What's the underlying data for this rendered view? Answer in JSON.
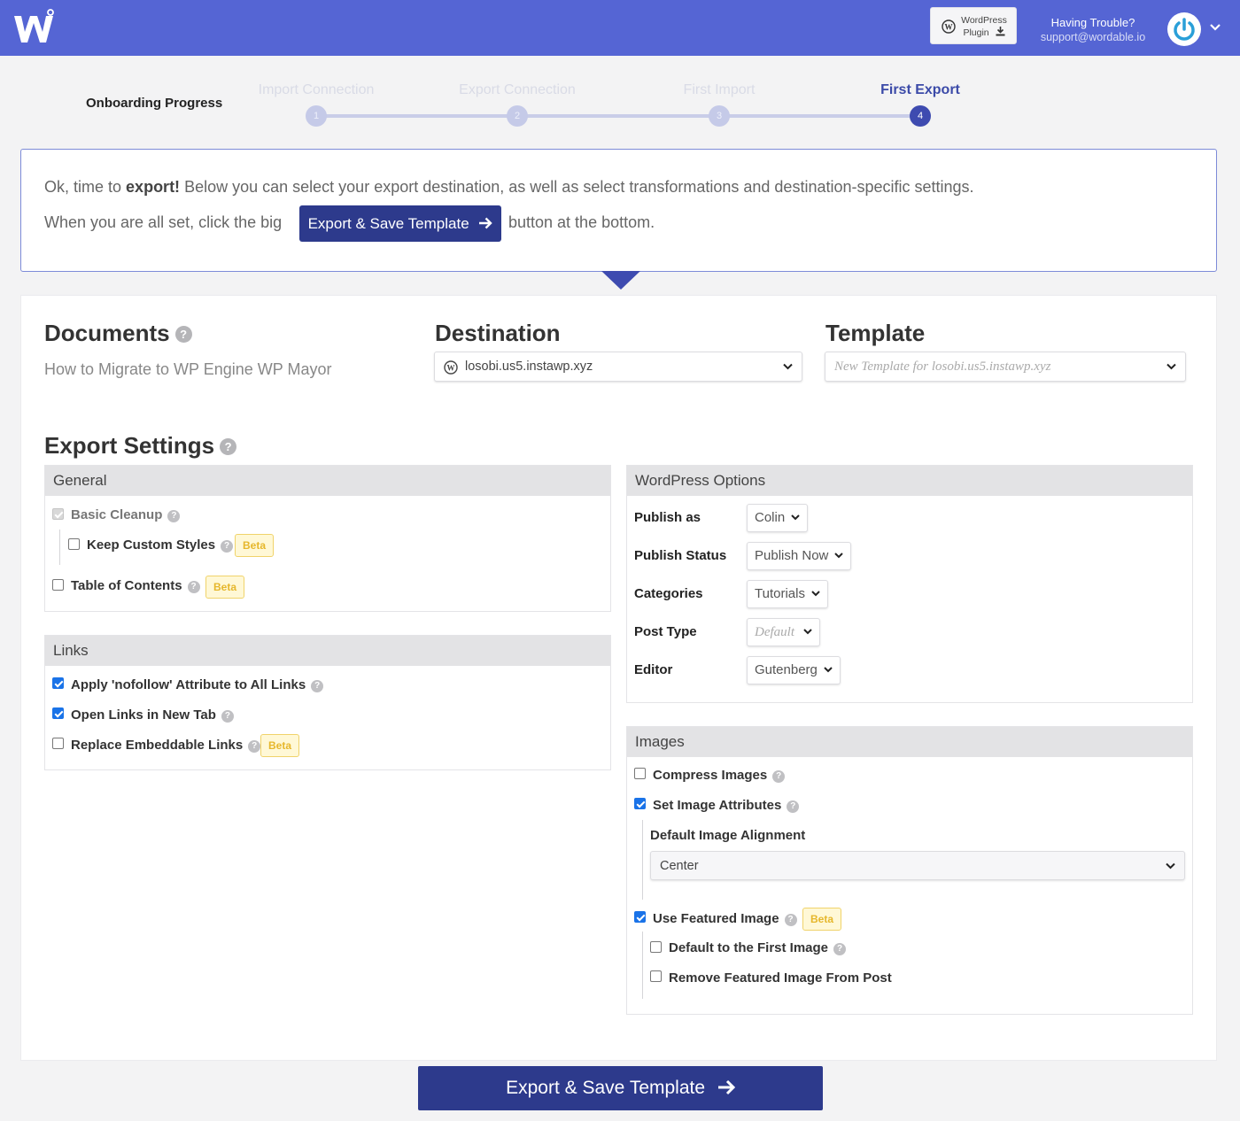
{
  "header": {
    "plugin_line1": "WordPress",
    "plugin_line2": "Plugin",
    "trouble_title": "Having Trouble?",
    "trouble_email": "support@wordable.io"
  },
  "onboarding": {
    "title": "Onboarding Progress",
    "steps": [
      {
        "label": "Import Connection",
        "num": "1"
      },
      {
        "label": "Export Connection",
        "num": "2"
      },
      {
        "label": "First Import",
        "num": "3"
      },
      {
        "label": "First Export",
        "num": "4"
      }
    ]
  },
  "intro": {
    "line1_a": "Ok, time to",
    "line1_bold": "export!",
    "line1_b": "Below you can select your export destination, as well as select transformations and destination-specific settings.",
    "line2_a": "When you are all set, click the big",
    "button": "Export & Save Template",
    "line2_b": "button at the bottom."
  },
  "documents": {
    "title": "Documents",
    "value": "How to Migrate to WP Engine WP Mayor"
  },
  "destination": {
    "title": "Destination",
    "value": "losobi.us5.instawp.xyz"
  },
  "template": {
    "title": "Template",
    "placeholder": "New Template for losobi.us5.instawp.xyz"
  },
  "export_settings": {
    "title": "Export Settings"
  },
  "general": {
    "title": "General",
    "basic_cleanup": "Basic Cleanup",
    "keep_custom_styles": "Keep Custom Styles",
    "table_of_contents": "Table of Contents",
    "beta": "Beta"
  },
  "links": {
    "title": "Links",
    "nofollow": "Apply 'nofollow' Attribute to All Links",
    "new_tab": "Open Links in New Tab",
    "embeddable": "Replace Embeddable Links",
    "beta": "Beta"
  },
  "wp_options": {
    "title": "WordPress Options",
    "publish_as_label": "Publish as",
    "publish_as": "Colin",
    "publish_status_label": "Publish Status",
    "publish_status": "Publish Now",
    "categories_label": "Categories",
    "categories": "Tutorials",
    "post_type_label": "Post Type",
    "post_type": "Default",
    "editor_label": "Editor",
    "editor": "Gutenberg"
  },
  "images": {
    "title": "Images",
    "compress": "Compress Images",
    "set_attrs": "Set Image Attributes",
    "alignment_label": "Default Image Alignment",
    "alignment": "Center",
    "featured": "Use Featured Image",
    "beta": "Beta",
    "default_first": "Default to the First Image",
    "remove_featured": "Remove Featured Image From Post"
  },
  "footer": {
    "button": "Export & Save Template"
  },
  "colors": {
    "header": "#5565d4",
    "primary_button": "#2d3a8c",
    "accent": "#3e4bb0",
    "beta_bg": "#fff8d6",
    "checkbox": "#1a73e8"
  }
}
